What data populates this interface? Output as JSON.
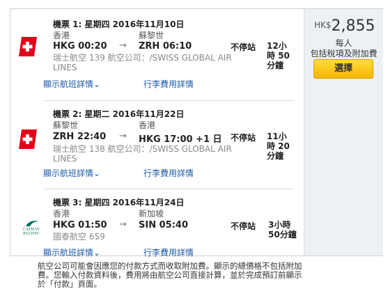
{
  "price": {
    "currency": "HK$",
    "amount": "2,855",
    "per_person": "每人",
    "includes": "包括稅項及附加費",
    "select_label": "選擇"
  },
  "segments": [
    {
      "title": "機票 1: 星期四 2016年11月10日",
      "from_city": "香港",
      "to_city": "蘇黎世",
      "dep": "HKG 00:20",
      "arr": "ZRH 06:10",
      "stops": "不停站",
      "duration": "12小時 50分鐘",
      "airline": "瑞士航空 139 航空公司：/SWISS GLOBAL AIR LINES",
      "flight_details": "顯示航班詳情",
      "baggage": "行李費用詳情"
    },
    {
      "title": "機票 2: 星期二 2016年11月22日",
      "from_city": "蘇黎世",
      "to_city": "香港",
      "dep": "ZRH 22:40",
      "arr": "HKG 17:00 +1 日",
      "stops": "不停站",
      "duration": "11小時 20分鐘",
      "airline": "瑞士航空 138 航空公司：/SWISS GLOBAL AIR LINES",
      "flight_details": "顯示航班詳情",
      "baggage": "行李費用詳情"
    },
    {
      "title": "機票 3: 星期四 2016年11月24日",
      "from_city": "香港",
      "to_city": "新加坡",
      "dep": "HKG 01:50",
      "arr": "SIN 05:40",
      "stops": "不停站",
      "duration": "3小時 50分鐘",
      "airline": "國泰航空 659",
      "flight_details": "顯示航班詳情",
      "baggage": "行李費用詳情",
      "logo_text": "CATHAY PACIFIC"
    }
  ],
  "note": "航空公司可能會因應您的付款方式而收取附加費。顯示的總價格不包括附加費。您輸入付款資料後，費用將由航空公司直接計算，並於完成預訂前顯示於「付款」頁面。",
  "colors": {
    "link": "#1b59a8",
    "swiss_red": "#e3001b",
    "cathay_green": "#006b5e",
    "button": "#f6b600"
  },
  "icons": {
    "chevron": "chevron-down-icon",
    "arrow": "arrow-right-icon"
  }
}
